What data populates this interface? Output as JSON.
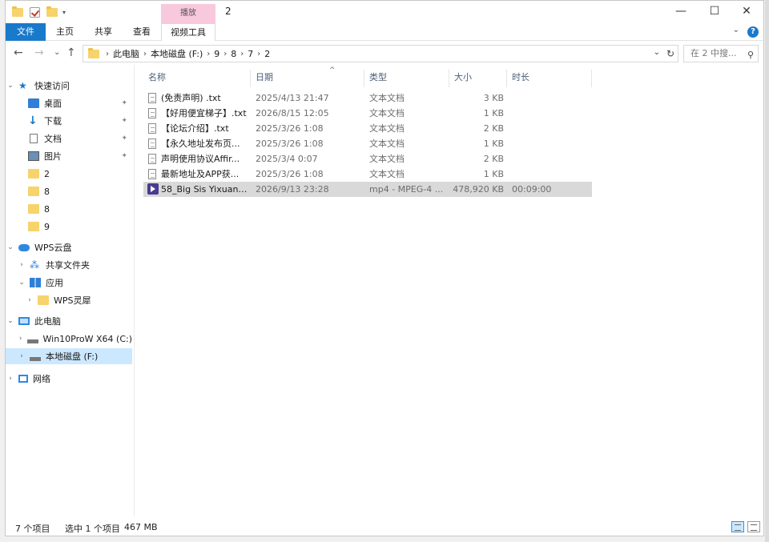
{
  "window": {
    "title": "2",
    "context_tab_header": "播放",
    "controls": {
      "minimize": "—",
      "maximize": "☐",
      "close": "✕"
    }
  },
  "ribbon": {
    "tabs": [
      {
        "label": "文件"
      },
      {
        "label": "主页"
      },
      {
        "label": "共享"
      },
      {
        "label": "查看"
      },
      {
        "label": "视频工具"
      }
    ],
    "help": "?"
  },
  "navigation": {
    "back": "←",
    "forward": "→",
    "recent": "⌄",
    "up": "↑",
    "breadcrumb": [
      "此电脑",
      "本地磁盘 (F:)",
      "9",
      "8",
      "7",
      "2"
    ],
    "search_placeholder": "在 2 中搜..."
  },
  "sidebar": {
    "quick_access": "快速访问",
    "quick_items": [
      "桌面",
      "下载",
      "文档",
      "图片",
      "2",
      "8",
      "8",
      "9"
    ],
    "wps_cloud": "WPS云盘",
    "shared_folder": "共享文件夹",
    "apps": "应用",
    "wps_lingxi": "WPS灵犀",
    "this_pc": "此电脑",
    "drive_c": "Win10ProW X64 (C:)",
    "drive_f": "本地磁盘 (F:)",
    "network": "网络"
  },
  "columns": {
    "name": "名称",
    "date": "日期",
    "type": "类型",
    "size": "大小",
    "duration": "时长"
  },
  "files": [
    {
      "name": "(免责声明) .txt",
      "date": "2025/4/13 21:47",
      "type": "文本文档",
      "size": "3 KB",
      "duration": "",
      "kind": "txt"
    },
    {
      "name": "【好用便宜梯子】.txt",
      "date": "2026/8/15 12:05",
      "type": "文本文档",
      "size": "1 KB",
      "duration": "",
      "kind": "txt"
    },
    {
      "name": "【论坛介绍】.txt",
      "date": "2025/3/26 1:08",
      "type": "文本文档",
      "size": "2 KB",
      "duration": "",
      "kind": "txt"
    },
    {
      "name": "【永久地址发布页...",
      "date": "2025/3/26 1:08",
      "type": "文本文档",
      "size": "1 KB",
      "duration": "",
      "kind": "txt"
    },
    {
      "name": "声明使用协议Affir...",
      "date": "2025/3/4 0:07",
      "type": "文本文档",
      "size": "2 KB",
      "duration": "",
      "kind": "txt"
    },
    {
      "name": "最新地址及APP获...",
      "date": "2025/3/26 1:08",
      "type": "文本文档",
      "size": "1 KB",
      "duration": "",
      "kind": "txt"
    },
    {
      "name": "58_Big Sis YixuanF...",
      "date": "2026/9/13 23:28",
      "type": "mp4 - MPEG-4 ...",
      "size": "478,920 KB",
      "duration": "00:09:00",
      "kind": "mp4",
      "selected": true
    }
  ],
  "status": {
    "item_count": "7 个项目",
    "selected": "选中 1 个项目",
    "selected_size": "467 MB"
  },
  "colors": {
    "accent": "#1979ca",
    "selection": "#cce8ff",
    "row_selected": "#d9d9d9",
    "context_tab": "#f8c8dc"
  }
}
